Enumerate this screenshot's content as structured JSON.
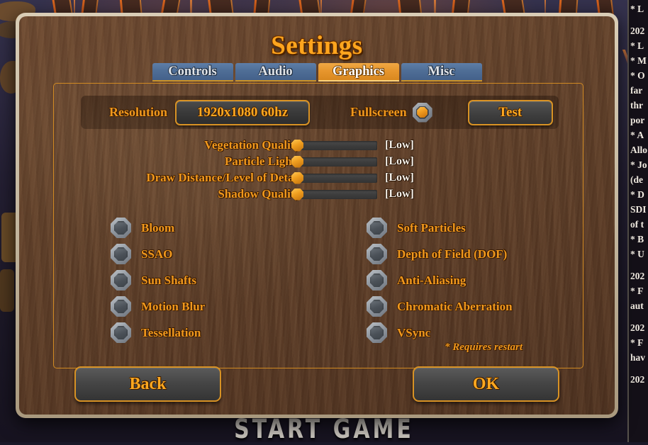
{
  "window": {
    "title": "Settings",
    "start_game_label": "START GAME"
  },
  "tabs": [
    {
      "label": "Controls",
      "active": false
    },
    {
      "label": "Audio",
      "active": false
    },
    {
      "label": "Graphics",
      "active": true
    },
    {
      "label": "Misc",
      "active": false
    }
  ],
  "display": {
    "resolution_label": "Resolution",
    "resolution_value": "1920x1080  60hz",
    "fullscreen_label": "Fullscreen",
    "fullscreen_enabled": true,
    "test_label": "Test"
  },
  "sliders": [
    {
      "label": "Vegetation Quality",
      "value": "[Low]",
      "percent": 0
    },
    {
      "label": "Particle Lights",
      "value": "[Low]",
      "percent": 0
    },
    {
      "label": "Draw Distance/Level of Detail",
      "value": "[Low]",
      "percent": 0
    },
    {
      "label": "Shadow Quality",
      "value": "[Low]",
      "percent": 0
    }
  ],
  "toggles_left": [
    {
      "label": "Bloom",
      "checked": false
    },
    {
      "label": "SSAO",
      "checked": false
    },
    {
      "label": "Sun Shafts",
      "checked": false
    },
    {
      "label": "Motion Blur",
      "checked": false
    },
    {
      "label": "Tessellation",
      "checked": false
    }
  ],
  "toggles_right": [
    {
      "label": "Soft Particles",
      "checked": false
    },
    {
      "label": "Depth of Field (DOF)",
      "checked": false
    },
    {
      "label": "Anti-Aliasing",
      "checked": false
    },
    {
      "label": "Chromatic Aberration",
      "checked": false
    },
    {
      "label": "VSync",
      "checked": false
    }
  ],
  "restart_note": "* Requires restart",
  "footer": {
    "back_label": "Back",
    "ok_label": "OK"
  },
  "changelog": [
    "* L",
    "",
    "202",
    "* L",
    "* M",
    "* O",
    "far",
    "thr",
    "por",
    "* A",
    "Allo",
    "* Jo",
    "(de",
    "* D",
    "SDI",
    "of t",
    "* B",
    "* U",
    "",
    "202",
    "* F",
    "aut",
    "",
    "202",
    "* F",
    "hav",
    "",
    "202"
  ],
  "colors": {
    "accent_orange": "#ffa51e",
    "label_orange": "#f0981d",
    "tab_active": "#e6952c",
    "tab_inactive": "#4f6e96",
    "panel_border": "#d18a22",
    "dialog_frame": "#c4b79f",
    "dialog_wood": "#63422b",
    "value_text": "#f3efe8"
  }
}
